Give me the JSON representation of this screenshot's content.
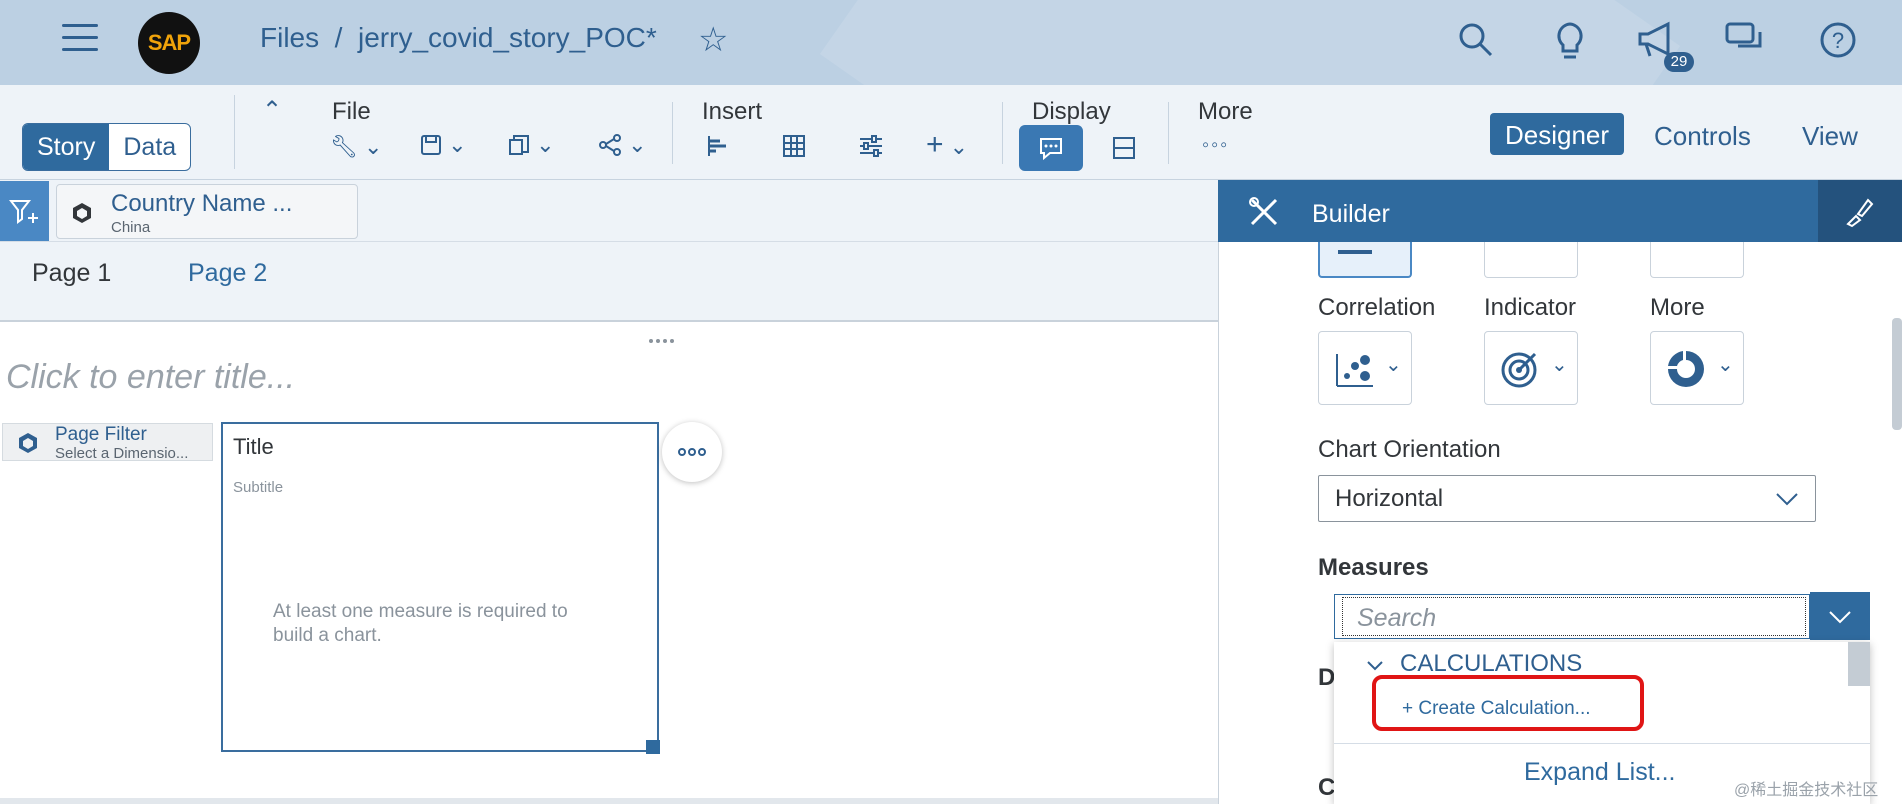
{
  "shell": {
    "logo": "SAP",
    "breadcrumb": "Files  /  jerry_covid_story_POC*",
    "notification_count": "29"
  },
  "toolbar": {
    "story_tab": "Story",
    "data_tab": "Data",
    "file_label": "File",
    "insert_label": "Insert",
    "display_label": "Display",
    "more_label": "More",
    "designer": "Designer",
    "controls": "Controls",
    "view": "View"
  },
  "filter": {
    "chip_title": "Country Name ...",
    "chip_value": "China"
  },
  "pages": {
    "page1": "Page 1",
    "page2": "Page 2"
  },
  "canvas": {
    "title_placeholder": "Click to enter title...",
    "page_filter_title": "Page Filter",
    "page_filter_sub": "Select a Dimensio...",
    "card_title": "Title",
    "card_subtitle": "Subtitle",
    "card_message": "At least one measure is required to build a chart."
  },
  "builder": {
    "header": "Builder",
    "type_labels": [
      "Correlation",
      "Indicator",
      "More"
    ],
    "orientation_label": "Chart Orientation",
    "orientation_value": "Horizontal",
    "measures_label": "Measures",
    "search_placeholder": "Search",
    "group_label": "CALCULATIONS",
    "create_calc": "+ Create Calculation...",
    "expand_list": "Expand List...",
    "behind_d": "D",
    "behind_c": "C"
  },
  "watermark": "@稀土掘金技术社区",
  "colors": {
    "accent": "#2f6a9e",
    "highlight": "#e01515"
  }
}
